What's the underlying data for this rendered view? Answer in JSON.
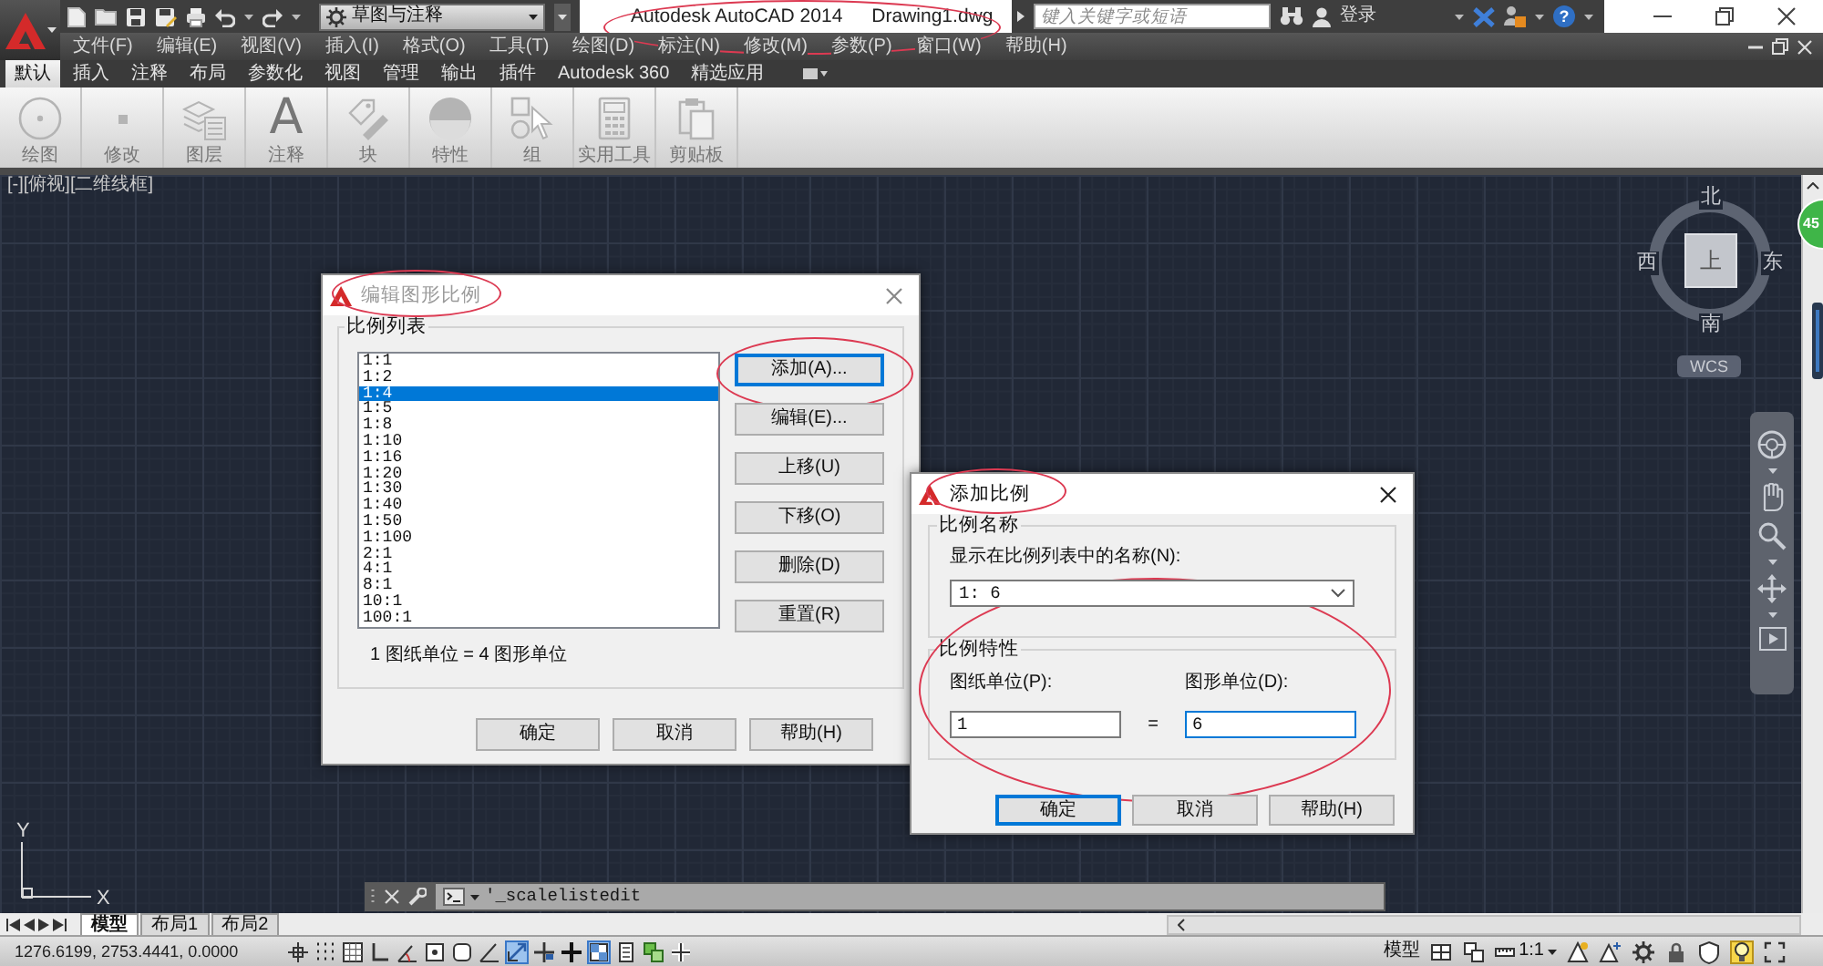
{
  "title_bar": {
    "product": "Autodesk AutoCAD 2014",
    "file": "Drawing1.dwg",
    "circled": true,
    "workspace": "草图与注释",
    "search_placeholder": "键入关键字或短语",
    "sign_in": "登录",
    "help_glyph": "?"
  },
  "menu": [
    "文件(F)",
    "编辑(E)",
    "视图(V)",
    "插入(I)",
    "格式(O)",
    "工具(T)",
    "绘图(D)",
    "标注(N)",
    "修改(M)",
    "参数(P)",
    "窗口(W)",
    "帮助(H)"
  ],
  "ribbon": {
    "tabs": [
      {
        "label": "默认",
        "selected": true
      },
      {
        "label": "插入",
        "selected": false
      },
      {
        "label": "注释",
        "selected": false
      },
      {
        "label": "布局",
        "selected": false
      },
      {
        "label": "参数化",
        "selected": false
      },
      {
        "label": "视图",
        "selected": false
      },
      {
        "label": "管理",
        "selected": false
      },
      {
        "label": "输出",
        "selected": false
      },
      {
        "label": "插件",
        "selected": false
      },
      {
        "label": "Autodesk 360",
        "selected": false
      },
      {
        "label": "精选应用",
        "selected": false
      }
    ],
    "panels": [
      {
        "kind": "draw",
        "label": "绘图",
        "disabled": true
      },
      {
        "kind": "modify",
        "label": "修改",
        "disabled": true
      },
      {
        "kind": "layers",
        "label": "图层",
        "disabled": true
      },
      {
        "kind": "annotation",
        "label": "注释",
        "glyph": "A",
        "disabled": true
      },
      {
        "kind": "block",
        "label": "块",
        "disabled": true
      },
      {
        "kind": "properties",
        "label": "特性",
        "disabled": true
      },
      {
        "kind": "group",
        "label": "组",
        "disabled": true
      },
      {
        "kind": "utilities",
        "label": "实用工具",
        "disabled": true
      },
      {
        "kind": "clipboard",
        "label": "剪贴板",
        "disabled": true
      }
    ]
  },
  "viewport": {
    "label": "[-][俯视][二维线框]",
    "compass": {
      "north": "北",
      "south": "南",
      "west": "西",
      "east": "东",
      "face": "上"
    },
    "ucs_button": "WCS",
    "axes": {
      "x": "X",
      "y": "Y"
    }
  },
  "floating_badge": "45",
  "scale_list_dialog": {
    "title": "编辑图形比例",
    "active": false,
    "title_circled": true,
    "group": "比例列表",
    "scales": [
      {
        "label": "1:1",
        "selected": false
      },
      {
        "label": "1:2",
        "selected": false
      },
      {
        "label": "1:4",
        "selected": true
      },
      {
        "label": "1:5",
        "selected": false
      },
      {
        "label": "1:8",
        "selected": false
      },
      {
        "label": "1:10",
        "selected": false
      },
      {
        "label": "1:16",
        "selected": false
      },
      {
        "label": "1:20",
        "selected": false
      },
      {
        "label": "1:30",
        "selected": false
      },
      {
        "label": "1:40",
        "selected": false
      },
      {
        "label": "1:50",
        "selected": false
      },
      {
        "label": "1:100",
        "selected": false
      },
      {
        "label": "2:1",
        "selected": false
      },
      {
        "label": "4:1",
        "selected": false
      },
      {
        "label": "8:1",
        "selected": false
      },
      {
        "label": "10:1",
        "selected": false
      },
      {
        "label": "100:1",
        "selected": false
      }
    ],
    "buttons": [
      {
        "label": "添加(A)...",
        "focused": true,
        "circled": true
      },
      {
        "label": "编辑(E)...",
        "focused": false,
        "circled": false
      },
      {
        "label": "上移(U)",
        "focused": false,
        "circled": false
      },
      {
        "label": "下移(O)",
        "focused": false,
        "circled": false
      },
      {
        "label": "删除(D)",
        "focused": false,
        "circled": false
      },
      {
        "label": "重置(R)",
        "focused": false,
        "circled": false
      }
    ],
    "ratio": "1 图纸单位 = 4 图形单位",
    "footer_buttons": [
      {
        "label": "确定",
        "focused": false
      },
      {
        "label": "取消",
        "focused": false
      },
      {
        "label": "帮助(H)",
        "focused": false
      }
    ]
  },
  "add_scale_dialog": {
    "title": "添加比例",
    "active": true,
    "title_circled": true,
    "fields_circled": true,
    "name_group": "比例名称",
    "name_label": "显示在比例列表中的名称(N):",
    "name_value": "1: 6",
    "property_group": "比例特性",
    "paper_units": {
      "label": "图纸单位(P):",
      "value": "1",
      "focused": false
    },
    "equals": "=",
    "drawing_units": {
      "label": "图形单位(D):",
      "value": "6",
      "focused": true
    },
    "buttons": [
      {
        "label": "确定",
        "focused": true
      },
      {
        "label": "取消",
        "focused": false
      },
      {
        "label": "帮助(H)",
        "focused": false
      }
    ]
  },
  "command_line": {
    "text": "'_scalelistedit"
  },
  "layout_tabs": [
    {
      "label": "模型",
      "selected": true
    },
    {
      "label": "布局1",
      "selected": false
    },
    {
      "label": "布局2",
      "selected": false
    }
  ],
  "status_bar": {
    "coordinates": "1276.6199, 2753.4441, 0.0000",
    "toggles": [
      {
        "kind": "infer",
        "on": false
      },
      {
        "kind": "snap",
        "on": false
      },
      {
        "kind": "grid",
        "on": false
      },
      {
        "kind": "ortho",
        "on": false
      },
      {
        "kind": "polar",
        "on": false
      },
      {
        "kind": "osnap",
        "on": false
      },
      {
        "kind": "osnap3d",
        "on": false
      },
      {
        "kind": "otrack",
        "on": false
      },
      {
        "kind": "ducs",
        "on": true
      },
      {
        "kind": "dyn",
        "on": false
      },
      {
        "kind": "lwt",
        "on": false
      },
      {
        "kind": "tpy",
        "on": true
      },
      {
        "kind": "qp",
        "on": false
      },
      {
        "kind": "sc",
        "on": false
      },
      {
        "kind": "am",
        "on": false
      }
    ],
    "space": "模型",
    "view_buttons": [
      {
        "kind": "layouts"
      },
      {
        "kind": "drawings"
      }
    ],
    "annotation_scale": "1:1",
    "tray": [
      {
        "kind": "visibility",
        "on": false
      },
      {
        "kind": "autoscale",
        "on": false
      },
      {
        "kind": "workspace",
        "on": false
      },
      {
        "kind": "lock",
        "on": false
      },
      {
        "kind": "performance",
        "on": false
      },
      {
        "kind": "isolate",
        "on": true
      },
      {
        "kind": "clean_screen",
        "on": false
      }
    ]
  }
}
